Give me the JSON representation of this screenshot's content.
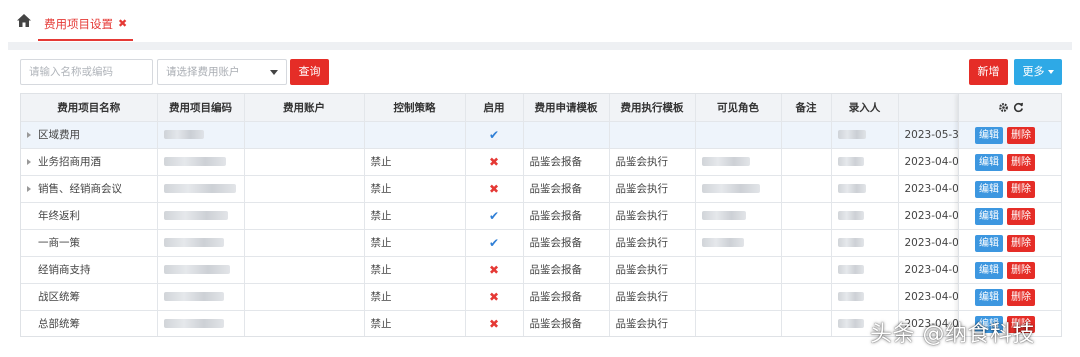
{
  "tab": {
    "label": "费用项目设置",
    "close_glyph": "✖"
  },
  "toolbar": {
    "name_placeholder": "请输入名称或编码",
    "account_placeholder": "请选择费用账户",
    "query_label": "查询",
    "new_label": "新增",
    "more_label": "更多"
  },
  "columns": [
    "费用项目名称",
    "费用项目编码",
    "费用账户",
    "控制策略",
    "启用",
    "费用申请模板",
    "费用执行模板",
    "可见角色",
    "备注",
    "录入人",
    "录入"
  ],
  "actions_header_icons": [
    "gear-icon",
    "refresh-icon"
  ],
  "rows": [
    {
      "name": "区域费用",
      "expandable": true,
      "strategy": "",
      "enabled": true,
      "apply_tpl": "",
      "exec_tpl": "",
      "date": "2023-05-3",
      "selected": true
    },
    {
      "name": "业务招商用酒",
      "expandable": true,
      "strategy": "禁止",
      "enabled": false,
      "apply_tpl": "品鉴会报备",
      "exec_tpl": "品鉴会执行",
      "date": "2023-04-0",
      "selected": false
    },
    {
      "name": "销售、经销商会议",
      "expandable": true,
      "strategy": "禁止",
      "enabled": false,
      "apply_tpl": "品鉴会报备",
      "exec_tpl": "品鉴会执行",
      "date": "2023-04-0",
      "selected": false
    },
    {
      "name": "年终返利",
      "expandable": false,
      "strategy": "禁止",
      "enabled": true,
      "apply_tpl": "品鉴会报备",
      "exec_tpl": "品鉴会执行",
      "date": "2023-04-0",
      "selected": false
    },
    {
      "name": "一商一策",
      "expandable": false,
      "strategy": "禁止",
      "enabled": true,
      "apply_tpl": "品鉴会报备",
      "exec_tpl": "品鉴会执行",
      "date": "2023-04-0",
      "selected": false
    },
    {
      "name": "经销商支持",
      "expandable": false,
      "strategy": "禁止",
      "enabled": false,
      "apply_tpl": "品鉴会报备",
      "exec_tpl": "品鉴会执行",
      "date": "2023-04-0",
      "selected": false
    },
    {
      "name": "战区统筹",
      "expandable": false,
      "strategy": "禁止",
      "enabled": false,
      "apply_tpl": "品鉴会报备",
      "exec_tpl": "品鉴会执行",
      "date": "2023-04-0",
      "selected": false
    },
    {
      "name": "总部统筹",
      "expandable": false,
      "strategy": "禁止",
      "enabled": false,
      "apply_tpl": "品鉴会报备",
      "exec_tpl": "品鉴会执行",
      "date": "2023-04-0",
      "selected": false
    }
  ],
  "row_actions": {
    "edit_label": "编辑",
    "delete_label": "删除"
  },
  "watermark": "头条 @纳食科技",
  "colors": {
    "accent_red": "#e52d27",
    "accent_blue": "#2ea9e6",
    "check_blue": "#2f7fd6"
  }
}
